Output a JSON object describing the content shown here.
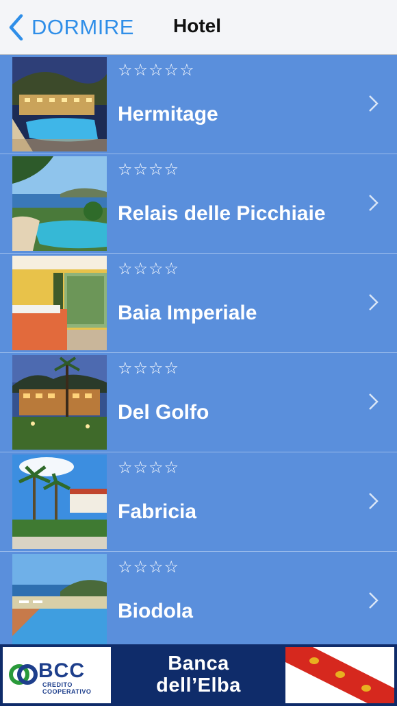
{
  "navbar": {
    "back_label": "DORMIRE",
    "title": "Hotel"
  },
  "hotels": [
    {
      "name": "Hermitage",
      "stars": "☆☆☆☆☆",
      "rating": 5,
      "photo": "pool-night-icon"
    },
    {
      "name": "Relais delle Picchiaie",
      "stars": "☆☆☆☆",
      "rating": 4,
      "photo": "pool-sea-icon"
    },
    {
      "name": "Baia Imperiale",
      "stars": "☆☆☆☆",
      "rating": 4,
      "photo": "room-icon"
    },
    {
      "name": "Del Golfo",
      "stars": "☆☆☆☆",
      "rating": 4,
      "photo": "hotel-night-icon"
    },
    {
      "name": "Fabricia",
      "stars": "☆☆☆☆",
      "rating": 4,
      "photo": "palms-icon"
    },
    {
      "name": "Biodola",
      "stars": "☆☆☆☆",
      "rating": 4,
      "photo": "pool-beach-icon"
    }
  ],
  "banner": {
    "bcc_name": "BCC",
    "bcc_sub": "CREDITO COOPERATIVO",
    "bank_line1": "Banca",
    "bank_line2": "dell’Elba"
  },
  "colors": {
    "row_bg": "#5a8fdc",
    "accent": "#2f8ee8",
    "banner_bg": "#0f2c6a"
  }
}
